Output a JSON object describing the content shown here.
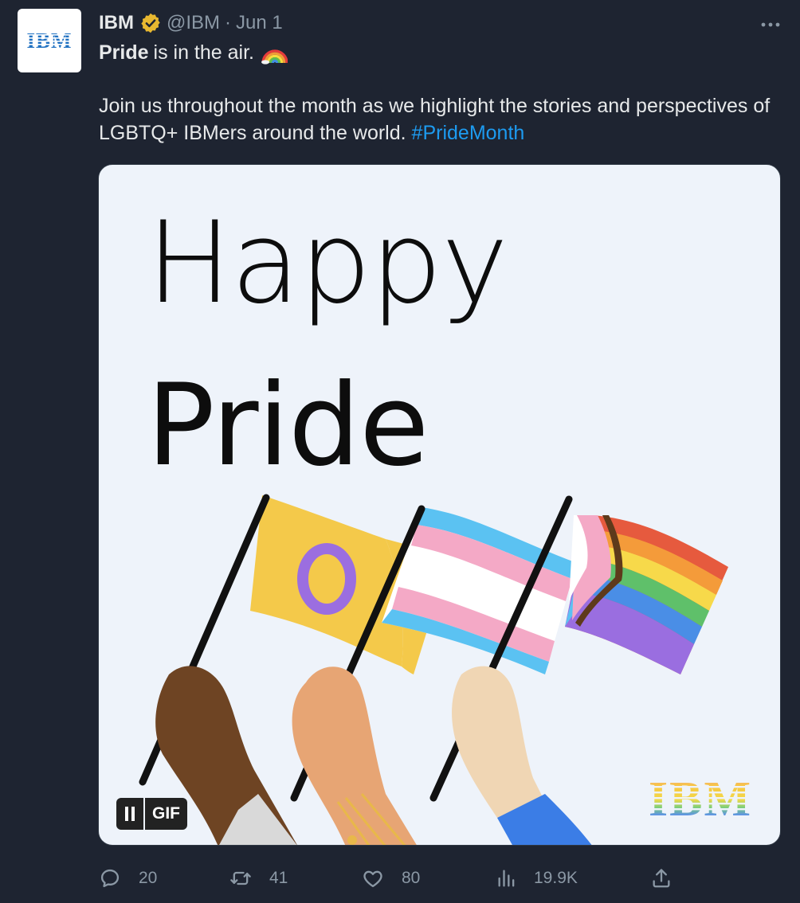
{
  "tweet": {
    "author_name": "IBM",
    "author_handle": "@IBM",
    "separator": "·",
    "date": "Jun 1",
    "avatar_logo": "IBM",
    "line1_bold": "Pride",
    "line1_rest": "is in the air.",
    "body": "Join us throughout the month as we highlight the stories and perspectives of LGBTQ+ IBMers around the world.",
    "hashtag": "#PrideMonth"
  },
  "media": {
    "headline_1": "Happy",
    "headline_2": "Pride",
    "gif_label": "GIF",
    "watermark": "IBM"
  },
  "actions": {
    "replies": "20",
    "retweets": "41",
    "likes": "80",
    "views": "19.9K"
  },
  "icons": {
    "verified": "verified-badge-icon",
    "more": "more-icon",
    "rainbow": "rainbow-icon",
    "reply": "reply-icon",
    "retweet": "retweet-icon",
    "like": "heart-icon",
    "views": "views-chart-icon",
    "share": "share-icon",
    "pause": "pause-icon"
  },
  "colors": {
    "background": "#1e2431",
    "text": "#e7e9ea",
    "muted": "#8b98a5",
    "link": "#1d9bf0",
    "badge": "#e8b830",
    "ibm_blue": "#1f70c1"
  }
}
